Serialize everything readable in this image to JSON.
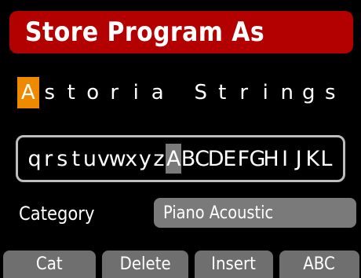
{
  "title": "Store Program As",
  "name_chars": [
    "A",
    "s",
    "t",
    "o",
    "r",
    "i",
    "a",
    " ",
    "S",
    "t",
    "r",
    "i",
    "n",
    "g",
    "s"
  ],
  "cursor_index": 0,
  "picker_chars": [
    "q",
    "r",
    "s",
    "t",
    "u",
    "v",
    "w",
    "x",
    "y",
    "z",
    "A",
    "B",
    "C",
    "D",
    "E",
    "F",
    "G",
    "H",
    "I",
    "J",
    "K",
    "L"
  ],
  "picker_selected_index": 10,
  "category": {
    "label": "Category",
    "value": "Piano Acoustic"
  },
  "softkeys": {
    "cat": "Cat",
    "delete": "Delete",
    "insert": "Insert",
    "abc": "ABC"
  },
  "colors": {
    "title_bar": "#b30000",
    "cursor": "#ee8a00",
    "selected_char": "#7a7a7a",
    "softkey": "#6f6f6f"
  }
}
